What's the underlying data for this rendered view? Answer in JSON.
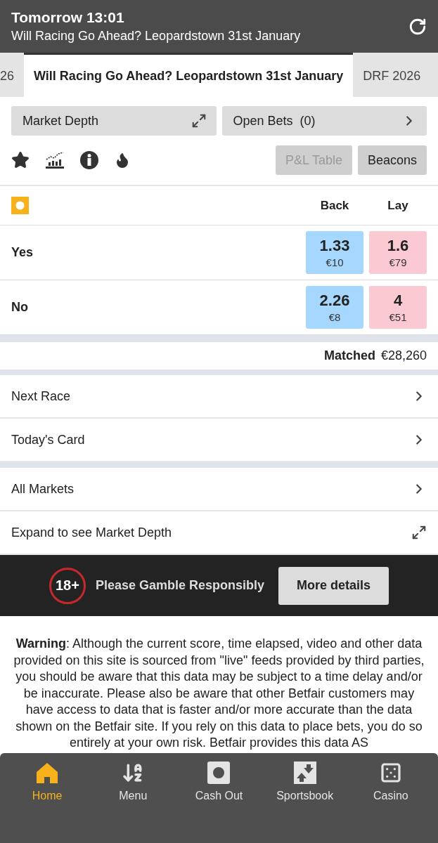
{
  "header": {
    "title": "Tomorrow 13:01",
    "subtitle": "Will Racing Go Ahead? Leopardstown 31st January"
  },
  "tabs": [
    {
      "label": "26",
      "selected": false
    },
    {
      "label": "Will Racing Go Ahead? Leopardstown 31st January",
      "selected": true
    },
    {
      "label": "DRF 2026",
      "selected": false
    }
  ],
  "actions": [
    {
      "label": "Market Depth",
      "kind": "expand"
    },
    {
      "label": "Open Bets  (0)",
      "kind": "chevron"
    }
  ],
  "toolbar_buttons": [
    {
      "label": "P&L Table",
      "disabled": true
    },
    {
      "label": "Beacons",
      "disabled": false
    }
  ],
  "market": {
    "columns": [
      "Back",
      "Lay"
    ],
    "runners": [
      {
        "name": "Yes",
        "back": {
          "price": "1.33",
          "size": "€10"
        },
        "lay": {
          "price": "1.6",
          "size": "€79"
        }
      },
      {
        "name": "No",
        "back": {
          "price": "2.26",
          "size": "€8"
        },
        "lay": {
          "price": "4",
          "size": "€51"
        }
      }
    ],
    "matched_label": "Matched",
    "matched_value": "€28,260"
  },
  "link_groups": [
    [
      {
        "label": "Next Race",
        "kind": "chevron"
      },
      {
        "label": "Today's Card",
        "kind": "chevron"
      }
    ],
    [
      {
        "label": "All Markets",
        "kind": "chevron"
      },
      {
        "label": "Expand to see Market Depth",
        "kind": "expand"
      }
    ]
  ],
  "banner": {
    "badge": "18+",
    "text": "Please Gamble Responsibly",
    "button": "More details"
  },
  "warning": "**Warning**: Although the current score, time elapsed, video and other data provided on this site is sourced from \"live\" feeds provided by third parties, you should be aware that this data may be subject to a time delay and/or be inaccurate.  Please also be aware that other Betfair customers may have access to data that is faster and/or more accurate than the data shown on the Betfair site. If you rely on this data to place bets, you do so entirely at your own risk. Betfair provides this data AS",
  "nav": [
    {
      "label": "Home",
      "kind": "home",
      "selected": true
    },
    {
      "label": "Menu",
      "kind": "az",
      "selected": false
    },
    {
      "label": "Cash Out",
      "kind": "cashout",
      "selected": false
    },
    {
      "label": "Sportsbook",
      "kind": "sportsbook",
      "selected": false
    },
    {
      "label": "Casino",
      "kind": "casino",
      "selected": false
    }
  ]
}
